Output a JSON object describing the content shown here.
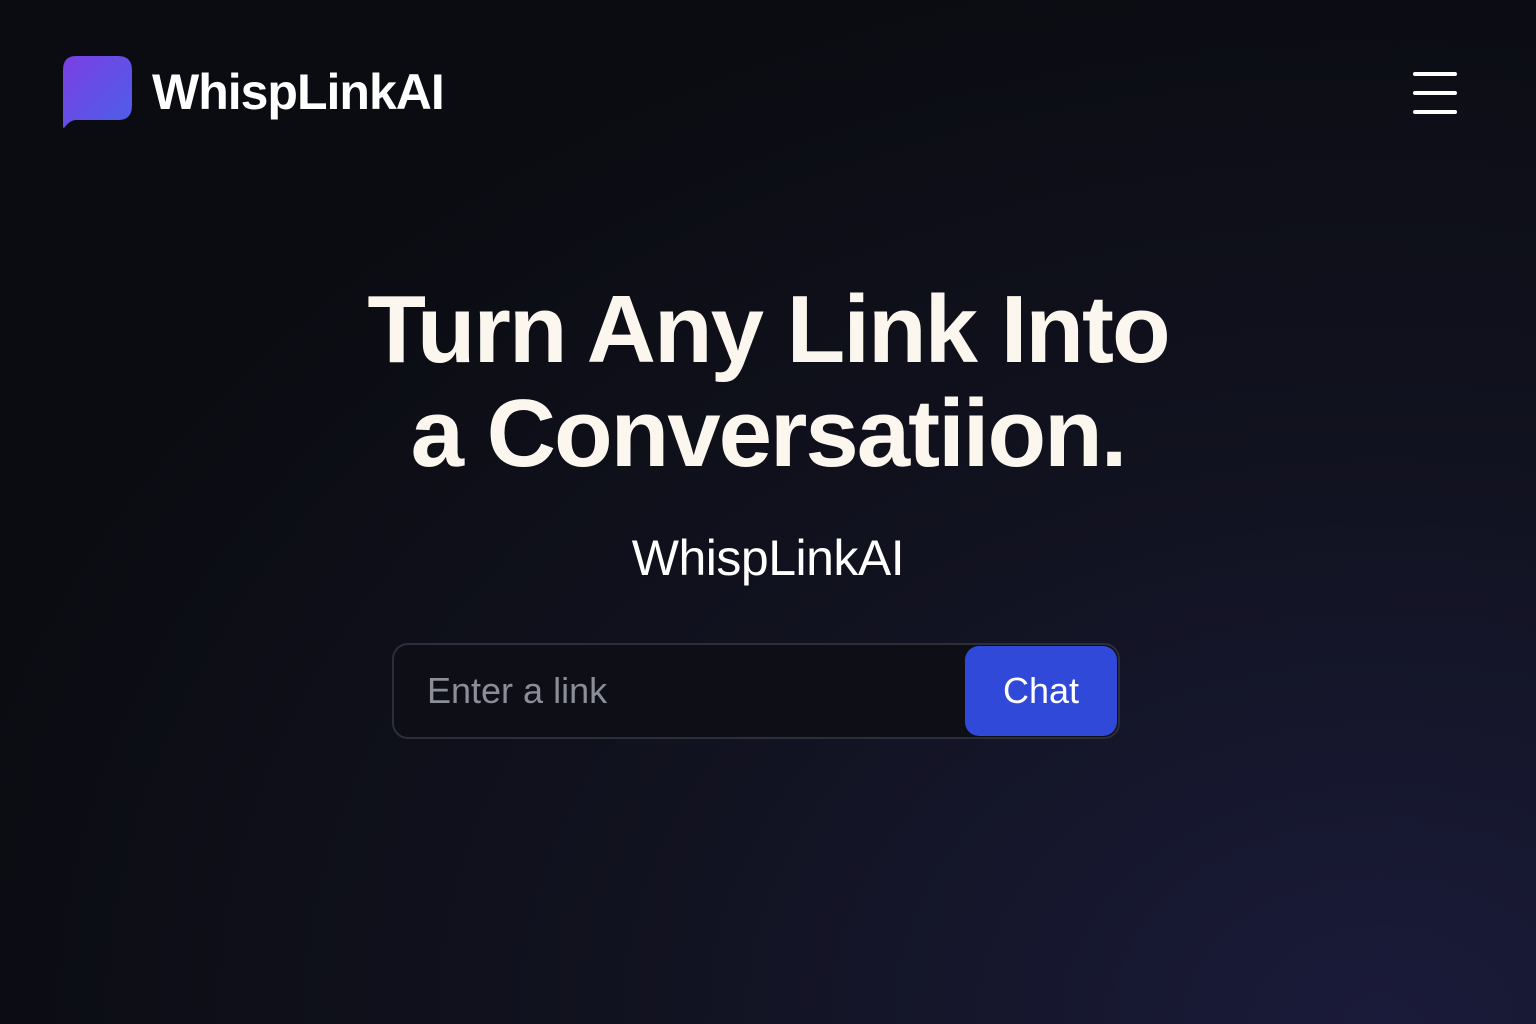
{
  "header": {
    "brand": "WhispLinkAI",
    "logo_icon": "chat-bubble-icon",
    "menu_icon": "hamburger-menu-icon"
  },
  "hero": {
    "title_line1": "Turn Any Link Into",
    "title_line2": "a Conversatiion.",
    "subtitle": "WhispLinkAI"
  },
  "form": {
    "input_value": "",
    "input_placeholder": "Enter a link",
    "submit_label": "Chat"
  },
  "colors": {
    "accent": "#3049d8",
    "logo_gradient_start": "#7b3fe4",
    "logo_gradient_end": "#4b5fe8",
    "background": "#0b0c12",
    "text": "#fbf7ee"
  }
}
